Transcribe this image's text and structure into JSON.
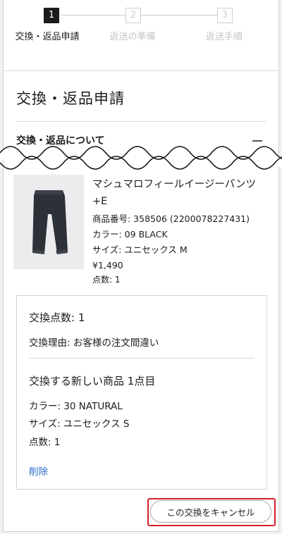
{
  "stepper": {
    "steps": [
      {
        "number": "1",
        "label": "交換・返品申請"
      },
      {
        "number": "2",
        "label": "返送の準備"
      },
      {
        "number": "3",
        "label": "返送手順"
      }
    ]
  },
  "page_title": "交換・返品申請",
  "accordion": {
    "title": "交換・返品について"
  },
  "product": {
    "name": "マシュマロフィールイージーパンツ+E",
    "item_number": "商品番号: 358506 (2200078227431)",
    "color": "カラー: 09 BLACK",
    "size": "サイズ: ユニセックス M",
    "price": "¥1,490",
    "quantity": "点数: 1"
  },
  "exchange": {
    "count": "交換点数: 1",
    "reason": "交換理由: お客様の注文間違い",
    "new_item_heading": "交換する新しい商品 1点目",
    "new_color": "カラー: 30 NATURAL",
    "new_size": "サイズ: ユニセックス S",
    "new_quantity": "点数: 1",
    "delete_label": "削除"
  },
  "cancel_button_label": "この交換をキャンセル",
  "colors": {
    "highlight": "#d2222d",
    "link": "#2a6fc9",
    "active_step": "#1b1b1b"
  }
}
